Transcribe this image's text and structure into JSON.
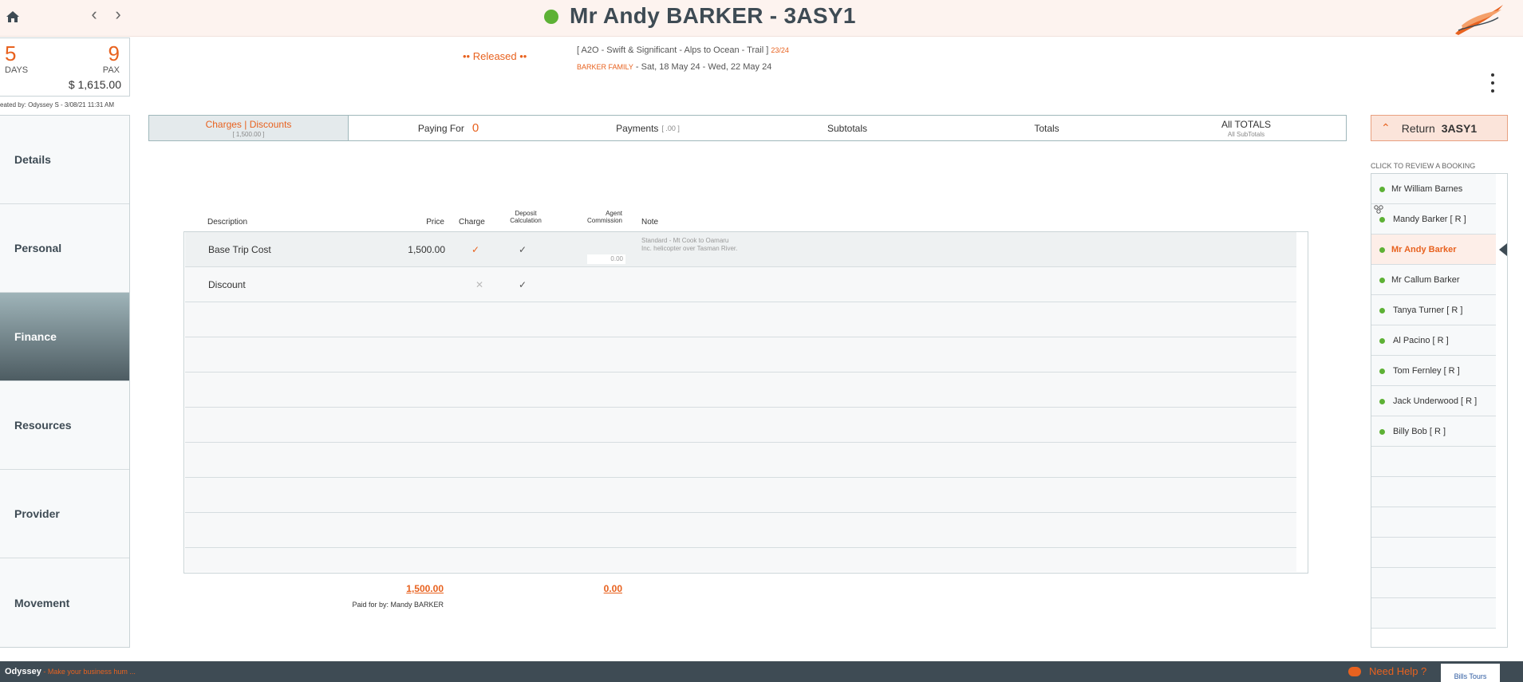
{
  "header": {
    "title": "Mr Andy BARKER - 3ASY1",
    "status_color": "#5db135"
  },
  "summary": {
    "days_value": "5",
    "days_label": "DAYS",
    "pax_value": "9",
    "pax_label": "PAX",
    "total": "$ 1,615.00",
    "created_by": "eated by: Odyssey S - 3/08/21 11:31 AM"
  },
  "booking_info": {
    "status": "•• Released ••",
    "trip": "[ A2O - Swift & Significant - Alps to Ocean - Trail ]",
    "season": "23/24",
    "family": "BARKER FAMILY",
    "dates": "- Sat, 18 May 24 - Wed, 22 May 24"
  },
  "sidebar": {
    "items": [
      {
        "label": "Details"
      },
      {
        "label": "Personal"
      },
      {
        "label": "Finance"
      },
      {
        "label": "Resources"
      },
      {
        "label": "Provider"
      },
      {
        "label": "Movement"
      }
    ]
  },
  "tabs": {
    "charges_label": "Charges | Discounts",
    "charges_sub": "[ 1,500.00 ]",
    "paying_for_label": "Paying For",
    "paying_for_count": "0",
    "payments_label": "Payments",
    "payments_sub": "[ .00 ]",
    "subtotals_label": "Subtotals",
    "totals_label": "Totals",
    "all_totals_label": "All TOTALS",
    "all_totals_sub": "All SubTotals"
  },
  "return": {
    "label": "Return",
    "code": "3ASY1"
  },
  "charges_table": {
    "columns": {
      "description": "Description",
      "price": "Price",
      "charge": "Charge",
      "deposit_1": "Deposit",
      "deposit_2": "Calculation",
      "agent_1": "Agent",
      "agent_2": "Commission",
      "note": "Note"
    },
    "rows": [
      {
        "description": "Base Trip Cost",
        "price": "1,500.00",
        "charge": "✓",
        "deposit": "✓",
        "commission": "0.00",
        "note_1": "Standard - Mt Cook to Oamaru",
        "note_2": "Inc. helicopter over Tasman River."
      },
      {
        "description": "Discount",
        "price": "",
        "charge": "✕",
        "deposit": "✓",
        "commission": "",
        "note_1": "",
        "note_2": ""
      }
    ],
    "total_price": "1,500.00",
    "total_commission": "0.00",
    "paid_for_by": "Paid for by: Mandy BARKER"
  },
  "bookings": {
    "review_label": "CLICK TO REVIEW A BOOKING",
    "items": [
      {
        "name": "Mr William Barnes"
      },
      {
        "name": "Mandy Barker  [ R ]"
      },
      {
        "name": "Mr Andy Barker"
      },
      {
        "name": "Mr Callum Barker"
      },
      {
        "name": "Tanya Turner  [ R ]"
      },
      {
        "name": "Al Pacino  [ R ]"
      },
      {
        "name": "Tom Fernley  [ R ]"
      },
      {
        "name": "Jack Underwood  [ R ]"
      },
      {
        "name": "Billy Bob  [ R ]"
      }
    ]
  },
  "footer": {
    "brand": "Odyssey",
    "tagline": " - Make your business hum ...",
    "help": "Need Help ?",
    "partner_logo": "Bills Tours"
  },
  "colors": {
    "accent": "#e8621f",
    "dark": "#3e4b54",
    "status_green": "#5db135"
  }
}
